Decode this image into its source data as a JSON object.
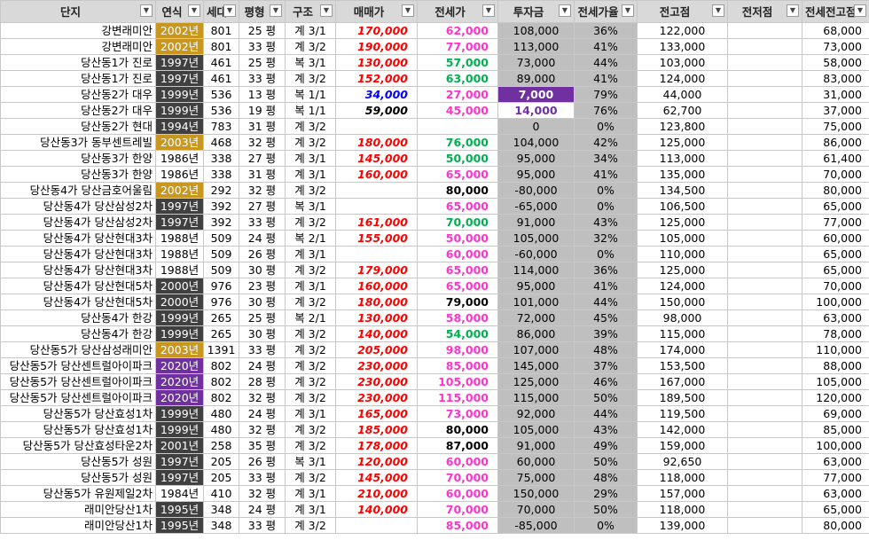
{
  "columns": [
    "단지",
    "연식",
    "세대",
    "평형",
    "구조",
    "매매가",
    "전세가",
    "투자금",
    "전세가율",
    "전고점",
    "전저점",
    "전세전고점"
  ],
  "rows": [
    [
      "강변래미안",
      "2002년",
      "801",
      "25 평",
      "계 3/1",
      "170,000",
      "62,000",
      "108,000",
      "36%",
      "122,000",
      "",
      "68,000"
    ],
    [
      "강변래미안",
      "2002년",
      "801",
      "33 평",
      "계 3/2",
      "190,000",
      "77,000",
      "113,000",
      "41%",
      "133,000",
      "",
      "73,000"
    ],
    [
      "당산동1가 진로",
      "1997년",
      "461",
      "25 평",
      "복 3/1",
      "130,000",
      "57,000",
      "73,000",
      "44%",
      "103,000",
      "",
      "58,000"
    ],
    [
      "당산동1가 진로",
      "1997년",
      "461",
      "33 평",
      "계 3/2",
      "152,000",
      "63,000",
      "89,000",
      "41%",
      "124,000",
      "",
      "83,000"
    ],
    [
      "당산동2가 대우",
      "1999년",
      "536",
      "13 평",
      "복 1/1",
      "34,000",
      "27,000",
      "7,000",
      "79%",
      "44,000",
      "",
      "31,000"
    ],
    [
      "당산동2가 대우",
      "1999년",
      "536",
      "19 평",
      "복 1/1",
      "59,000",
      "45,000",
      "14,000",
      "76%",
      "62,700",
      "",
      "37,000"
    ],
    [
      "당산동2가 현대",
      "1994년",
      "783",
      "31 평",
      "계 3/2",
      "",
      "",
      "0",
      "0%",
      "123,800",
      "",
      "75,000"
    ],
    [
      "당산동3가 동부센트레빌",
      "2003년",
      "468",
      "32 평",
      "계 3/2",
      "180,000",
      "76,000",
      "104,000",
      "42%",
      "125,000",
      "",
      "86,000"
    ],
    [
      "당산동3가 한양",
      "1986년",
      "338",
      "27 평",
      "계 3/1",
      "145,000",
      "50,000",
      "95,000",
      "34%",
      "113,000",
      "",
      "61,400"
    ],
    [
      "당산동3가 한양",
      "1986년",
      "338",
      "31 평",
      "계 3/1",
      "160,000",
      "65,000",
      "95,000",
      "41%",
      "135,000",
      "",
      "70,000"
    ],
    [
      "당산동4가 당산금호어울림",
      "2002년",
      "292",
      "32 평",
      "계 3/2",
      "",
      "80,000",
      "-80,000",
      "0%",
      "134,500",
      "",
      "80,000"
    ],
    [
      "당산동4가 당산삼성2차",
      "1997년",
      "392",
      "27 평",
      "복 3/1",
      "",
      "65,000",
      "-65,000",
      "0%",
      "106,500",
      "",
      "65,000"
    ],
    [
      "당산동4가 당산삼성2차",
      "1997년",
      "392",
      "33 평",
      "계 3/2",
      "161,000",
      "70,000",
      "91,000",
      "43%",
      "125,000",
      "",
      "77,000"
    ],
    [
      "당산동4가 당산현대3차",
      "1988년",
      "509",
      "24 평",
      "복 2/1",
      "155,000",
      "50,000",
      "105,000",
      "32%",
      "105,000",
      "",
      "60,000"
    ],
    [
      "당산동4가 당산현대3차",
      "1988년",
      "509",
      "26 평",
      "계 3/1",
      "",
      "60,000",
      "-60,000",
      "0%",
      "110,000",
      "",
      "65,000"
    ],
    [
      "당산동4가 당산현대3차",
      "1988년",
      "509",
      "30 평",
      "계 3/2",
      "179,000",
      "65,000",
      "114,000",
      "36%",
      "125,000",
      "",
      "65,000"
    ],
    [
      "당산동4가 당산현대5차",
      "2000년",
      "976",
      "23 평",
      "계 3/1",
      "160,000",
      "65,000",
      "95,000",
      "41%",
      "124,000",
      "",
      "70,000"
    ],
    [
      "당산동4가 당산현대5차",
      "2000년",
      "976",
      "30 평",
      "계 3/2",
      "180,000",
      "79,000",
      "101,000",
      "44%",
      "150,000",
      "",
      "100,000"
    ],
    [
      "당산동4가 한강",
      "1999년",
      "265",
      "25 평",
      "복 2/1",
      "130,000",
      "58,000",
      "72,000",
      "45%",
      "98,000",
      "",
      "63,000"
    ],
    [
      "당산동4가 한강",
      "1999년",
      "265",
      "30 평",
      "계 3/2",
      "140,000",
      "54,000",
      "86,000",
      "39%",
      "115,000",
      "",
      "78,000"
    ],
    [
      "당산동5가 당산삼성래미안",
      "2003년",
      "1391",
      "33 평",
      "계 3/2",
      "205,000",
      "98,000",
      "107,000",
      "48%",
      "174,000",
      "",
      "110,000"
    ],
    [
      "당산동5가 당산센트럴아이파크",
      "2020년",
      "802",
      "24 평",
      "계 3/2",
      "230,000",
      "85,000",
      "145,000",
      "37%",
      "153,500",
      "",
      "88,000"
    ],
    [
      "당산동5가 당산센트럴아이파크",
      "2020년",
      "802",
      "28 평",
      "계 3/2",
      "230,000",
      "105,000",
      "125,000",
      "46%",
      "167,000",
      "",
      "105,000"
    ],
    [
      "당산동5가 당산센트럴아이파크",
      "2020년",
      "802",
      "32 평",
      "계 3/2",
      "230,000",
      "115,000",
      "115,000",
      "50%",
      "189,500",
      "",
      "120,000"
    ],
    [
      "당산동5가 당산효성1차",
      "1999년",
      "480",
      "24 평",
      "계 3/1",
      "165,000",
      "73,000",
      "92,000",
      "44%",
      "119,500",
      "",
      "69,000"
    ],
    [
      "당산동5가 당산효성1차",
      "1999년",
      "480",
      "32 평",
      "계 3/2",
      "185,000",
      "80,000",
      "105,000",
      "43%",
      "142,000",
      "",
      "85,000"
    ],
    [
      "당산동5가 당산효성타운2차",
      "2001년",
      "258",
      "35 평",
      "계 3/2",
      "178,000",
      "87,000",
      "91,000",
      "49%",
      "159,000",
      "",
      "100,000"
    ],
    [
      "당산동5가 성원",
      "1997년",
      "205",
      "26 평",
      "복 3/1",
      "120,000",
      "60,000",
      "60,000",
      "50%",
      "92,650",
      "",
      "63,000"
    ],
    [
      "당산동5가 성원",
      "1997년",
      "205",
      "33 평",
      "계 3/2",
      "145,000",
      "70,000",
      "75,000",
      "48%",
      "118,000",
      "",
      "77,000"
    ],
    [
      "당산동5가 유원제일2차",
      "1984년",
      "410",
      "32 평",
      "계 3/1",
      "210,000",
      "60,000",
      "150,000",
      "29%",
      "157,000",
      "",
      "63,000"
    ],
    [
      "래미안당산1차",
      "1995년",
      "348",
      "24 평",
      "계 3/1",
      "140,000",
      "70,000",
      "70,000",
      "50%",
      "118,000",
      "",
      "65,000"
    ],
    [
      "래미안당산1차",
      "1995년",
      "348",
      "33 평",
      "계 3/2",
      "",
      "85,000",
      "-85,000",
      "0%",
      "139,000",
      "",
      "80,000"
    ]
  ],
  "year_styles": [
    "orange",
    "orange",
    "dark",
    "dark",
    "dark",
    "dark",
    "dark",
    "orange",
    "none",
    "none",
    "orange",
    "dark",
    "dark",
    "none",
    "none",
    "none",
    "dark",
    "dark",
    "dark",
    "dark",
    "orange",
    "purple",
    "purple",
    "purple",
    "dark",
    "dark",
    "dark",
    "dark",
    "dark",
    "none",
    "dark",
    "dark"
  ],
  "sale_styles": [
    "red",
    "red",
    "red",
    "red",
    "blue",
    "black",
    "red",
    "red",
    "red",
    "red",
    "red",
    "red",
    "red",
    "red",
    "red",
    "red",
    "red",
    "red",
    "red",
    "red",
    "red",
    "red",
    "red",
    "red",
    "red",
    "red",
    "red",
    "red",
    "red",
    "red",
    "red",
    "red"
  ],
  "jeonse_styles": [
    "pink",
    "pink",
    "green",
    "green",
    "pink",
    "pink",
    "pink",
    "green",
    "green",
    "pink",
    "black",
    "pink",
    "green",
    "pink",
    "pink",
    "pink",
    "pink",
    "black",
    "pink",
    "green",
    "pink",
    "pink",
    "pink",
    "pink",
    "pink",
    "black",
    "black",
    "pink",
    "pink",
    "pink",
    "pink",
    "pink"
  ],
  "inv_highlight": {
    "4": "purple",
    "5": "white"
  },
  "colors": {
    "year_dark": "#404040",
    "year_orange": "#c9961e",
    "year_purple": "#7030a0",
    "sale_red": "#ff0000",
    "sale_blue": "#0000ff",
    "jeonse_pink": "#ff33cc",
    "jeonse_green": "#00b050",
    "shaded_col": "#bfbfbf",
    "header": "#d9d9d9"
  },
  "filter_icon": "dropdown-arrow-icon"
}
